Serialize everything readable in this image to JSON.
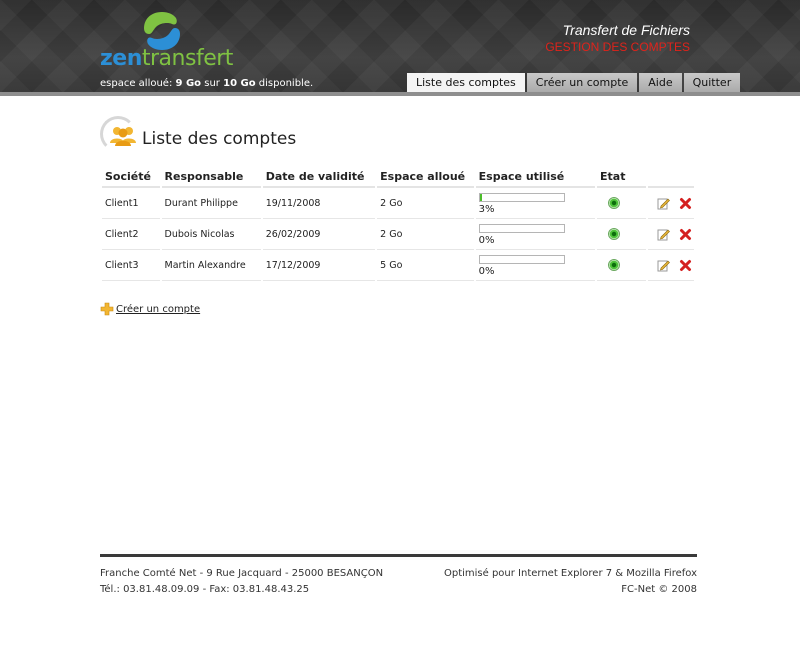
{
  "header": {
    "logo": {
      "part1": "zen",
      "part2": "transfert"
    },
    "space_info": {
      "prefix": "espace alloué:",
      "used": "9 Go",
      "middle": "sur",
      "total": "10 Go",
      "suffix": "disponible."
    },
    "tagline": "Transfert de Fichiers",
    "subtagline": "GESTION DES COMPTES",
    "tabs": [
      {
        "label": "Liste des comptes",
        "active": true
      },
      {
        "label": "Créer un compte",
        "active": false
      },
      {
        "label": "Aide",
        "active": false
      },
      {
        "label": "Quitter",
        "active": false
      }
    ]
  },
  "main": {
    "title": "Liste des comptes",
    "table": {
      "headers": [
        "Société",
        "Responsable",
        "Date de validité",
        "Espace alloué",
        "Espace utilisé",
        "Etat"
      ],
      "rows": [
        {
          "societe": "Client1",
          "responsable": "Durant Philippe",
          "date": "19/11/2008",
          "alloue": "2 Go",
          "utilise_pct": 3,
          "utilise_label": "3%",
          "etat": "active"
        },
        {
          "societe": "Client2",
          "responsable": "Dubois Nicolas",
          "date": "26/02/2009",
          "alloue": "2 Go",
          "utilise_pct": 0,
          "utilise_label": "0%",
          "etat": "active"
        },
        {
          "societe": "Client3",
          "responsable": "Martin Alexandre",
          "date": "17/12/2009",
          "alloue": "5 Go",
          "utilise_pct": 0,
          "utilise_label": "0%",
          "etat": "active"
        }
      ]
    },
    "create_link": "Créer un compte"
  },
  "footer": {
    "left_line1": "Franche Comté Net - 9 Rue Jacquard - 25000 BESANÇON",
    "left_line2": "Tél.: 03.81.48.09.09 - Fax: 03.81.48.43.25",
    "right_line1": "Optimisé pour Internet Explorer 7 & Mozilla Firefox",
    "right_line2": "FC-Net © 2008"
  },
  "colors": {
    "accent_red": "#e0231b",
    "progress_green": "#4cbd2b",
    "logo_blue": "#2c8fd6",
    "logo_green": "#7fc242"
  }
}
